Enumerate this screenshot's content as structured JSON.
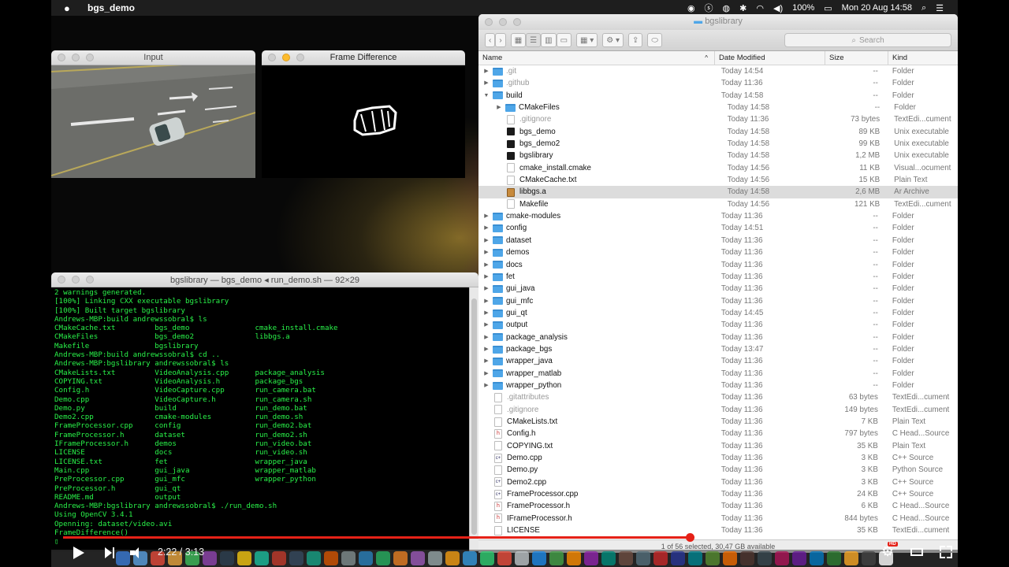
{
  "menubar": {
    "apple": "",
    "app_name": "bgs_demo",
    "battery": "100%",
    "datetime": "Mon 20 Aug  14:58"
  },
  "input_window": {
    "title": "Input"
  },
  "diff_window": {
    "title": "Frame Difference"
  },
  "terminal": {
    "title": "bgslibrary — bgs_demo ◂ run_demo.sh — 92×29",
    "lines": [
      "2 warnings generated.",
      "[100%] Linking CXX executable bgslibrary",
      "[100%] Built target bgslibrary",
      "Andrews-MBP:build andrewssobral$ ls",
      "CMakeCache.txt         bgs_demo               cmake_install.cmake",
      "CMakeFiles             bgs_demo2              libbgs.a",
      "Makefile               bgslibrary",
      "Andrews-MBP:build andrewssobral$ cd ..",
      "Andrews-MBP:bgslibrary andrewssobral$ ls",
      "CMakeLists.txt         VideoAnalysis.cpp      package_analysis",
      "COPYING.txt            VideoAnalysis.h        package_bgs",
      "Config.h               VideoCapture.cpp       run_camera.bat",
      "Demo.cpp               VideoCapture.h         run_camera.sh",
      "Demo.py                build                  run_demo.bat",
      "Demo2.cpp              cmake-modules          run_demo.sh",
      "FrameProcessor.cpp     config                 run_demo2.bat",
      "FrameProcessor.h       dataset                run_demo2.sh",
      "IFrameProcessor.h      demos                  run_video.bat",
      "LICENSE                docs                   run_video.sh",
      "LICENSE.txt            fet                    wrapper_java",
      "Main.cpp               gui_java               wrapper_matlab",
      "PreProcessor.cpp       gui_mfc                wrapper_python",
      "PreProcessor.h         gui_qt",
      "README.md              output",
      "Andrews-MBP:bgslibrary andrewssobral$ ./run_demo.sh",
      "Using OpenCV 3.4.1",
      "Openning: dataset/video.avi",
      "FrameDifference()",
      "▯"
    ]
  },
  "finder": {
    "title": "bgslibrary",
    "search_placeholder": "Search",
    "columns": {
      "name": "Name",
      "date": "Date Modified",
      "size": "Size",
      "kind": "Kind"
    },
    "rows": [
      {
        "indent": 0,
        "tri": "▶",
        "icon": "folder",
        "name": ".git",
        "date": "Today 14:54",
        "size": "--",
        "kind": "Folder",
        "dim": true
      },
      {
        "indent": 0,
        "tri": "▶",
        "icon": "folder",
        "name": ".github",
        "date": "Today 11:36",
        "size": "--",
        "kind": "Folder",
        "dim": true
      },
      {
        "indent": 0,
        "tri": "▼",
        "icon": "folder",
        "name": "build",
        "date": "Today 14:58",
        "size": "--",
        "kind": "Folder",
        "dim": false
      },
      {
        "indent": 1,
        "tri": "▶",
        "icon": "folder",
        "name": "CMakeFiles",
        "date": "Today 14:58",
        "size": "--",
        "kind": "Folder",
        "dim": false
      },
      {
        "indent": 1,
        "tri": "",
        "icon": "doc",
        "name": ".gitignore",
        "date": "Today 11:36",
        "size": "73 bytes",
        "kind": "TextEdi...cument",
        "dim": true
      },
      {
        "indent": 1,
        "tri": "",
        "icon": "exec",
        "name": "bgs_demo",
        "date": "Today 14:58",
        "size": "89 KB",
        "kind": "Unix executable",
        "dim": false
      },
      {
        "indent": 1,
        "tri": "",
        "icon": "exec",
        "name": "bgs_demo2",
        "date": "Today 14:58",
        "size": "99 KB",
        "kind": "Unix executable",
        "dim": false
      },
      {
        "indent": 1,
        "tri": "",
        "icon": "exec",
        "name": "bgslibrary",
        "date": "Today 14:58",
        "size": "1,2 MB",
        "kind": "Unix executable",
        "dim": false
      },
      {
        "indent": 1,
        "tri": "",
        "icon": "doc",
        "name": "cmake_install.cmake",
        "date": "Today 14:56",
        "size": "11 KB",
        "kind": "Visual...ocument",
        "dim": false
      },
      {
        "indent": 1,
        "tri": "",
        "icon": "doc",
        "name": "CMakeCache.txt",
        "date": "Today 14:56",
        "size": "15 KB",
        "kind": "Plain Text",
        "dim": false
      },
      {
        "indent": 1,
        "tri": "",
        "icon": "ar",
        "name": "libbgs.a",
        "date": "Today 14:58",
        "size": "2,6 MB",
        "kind": "Ar Archive",
        "dim": false,
        "sel": true
      },
      {
        "indent": 1,
        "tri": "",
        "icon": "doc",
        "name": "Makefile",
        "date": "Today 14:56",
        "size": "121 KB",
        "kind": "TextEdi...cument",
        "dim": false
      },
      {
        "indent": 0,
        "tri": "▶",
        "icon": "folder",
        "name": "cmake-modules",
        "date": "Today 11:36",
        "size": "--",
        "kind": "Folder",
        "dim": false
      },
      {
        "indent": 0,
        "tri": "▶",
        "icon": "folder",
        "name": "config",
        "date": "Today 14:51",
        "size": "--",
        "kind": "Folder",
        "dim": false
      },
      {
        "indent": 0,
        "tri": "▶",
        "icon": "folder",
        "name": "dataset",
        "date": "Today 11:36",
        "size": "--",
        "kind": "Folder",
        "dim": false
      },
      {
        "indent": 0,
        "tri": "▶",
        "icon": "folder",
        "name": "demos",
        "date": "Today 11:36",
        "size": "--",
        "kind": "Folder",
        "dim": false
      },
      {
        "indent": 0,
        "tri": "▶",
        "icon": "folder",
        "name": "docs",
        "date": "Today 11:36",
        "size": "--",
        "kind": "Folder",
        "dim": false
      },
      {
        "indent": 0,
        "tri": "▶",
        "icon": "folder",
        "name": "fet",
        "date": "Today 11:36",
        "size": "--",
        "kind": "Folder",
        "dim": false
      },
      {
        "indent": 0,
        "tri": "▶",
        "icon": "folder",
        "name": "gui_java",
        "date": "Today 11:36",
        "size": "--",
        "kind": "Folder",
        "dim": false
      },
      {
        "indent": 0,
        "tri": "▶",
        "icon": "folder",
        "name": "gui_mfc",
        "date": "Today 11:36",
        "size": "--",
        "kind": "Folder",
        "dim": false
      },
      {
        "indent": 0,
        "tri": "▶",
        "icon": "folder",
        "name": "gui_qt",
        "date": "Today 14:45",
        "size": "--",
        "kind": "Folder",
        "dim": false
      },
      {
        "indent": 0,
        "tri": "▶",
        "icon": "folder",
        "name": "output",
        "date": "Today 11:36",
        "size": "--",
        "kind": "Folder",
        "dim": false
      },
      {
        "indent": 0,
        "tri": "▶",
        "icon": "folder",
        "name": "package_analysis",
        "date": "Today 11:36",
        "size": "--",
        "kind": "Folder",
        "dim": false
      },
      {
        "indent": 0,
        "tri": "▶",
        "icon": "folder",
        "name": "package_bgs",
        "date": "Today 13:47",
        "size": "--",
        "kind": "Folder",
        "dim": false
      },
      {
        "indent": 0,
        "tri": "▶",
        "icon": "folder",
        "name": "wrapper_java",
        "date": "Today 11:36",
        "size": "--",
        "kind": "Folder",
        "dim": false
      },
      {
        "indent": 0,
        "tri": "▶",
        "icon": "folder",
        "name": "wrapper_matlab",
        "date": "Today 11:36",
        "size": "--",
        "kind": "Folder",
        "dim": false
      },
      {
        "indent": 0,
        "tri": "▶",
        "icon": "folder",
        "name": "wrapper_python",
        "date": "Today 11:36",
        "size": "--",
        "kind": "Folder",
        "dim": false
      },
      {
        "indent": 0,
        "tri": "",
        "icon": "doc",
        "name": ".gitattributes",
        "date": "Today 11:36",
        "size": "63 bytes",
        "kind": "TextEdi...cument",
        "dim": true
      },
      {
        "indent": 0,
        "tri": "",
        "icon": "doc",
        "name": ".gitignore",
        "date": "Today 11:36",
        "size": "149 bytes",
        "kind": "TextEdi...cument",
        "dim": true
      },
      {
        "indent": 0,
        "tri": "",
        "icon": "doc",
        "name": "CMakeLists.txt",
        "date": "Today 11:36",
        "size": "7 KB",
        "kind": "Plain Text",
        "dim": false
      },
      {
        "indent": 0,
        "tri": "",
        "icon": "h",
        "name": "Config.h",
        "date": "Today 11:36",
        "size": "797 bytes",
        "kind": "C Head...Source",
        "dim": false
      },
      {
        "indent": 0,
        "tri": "",
        "icon": "doc",
        "name": "COPYING.txt",
        "date": "Today 11:36",
        "size": "35 KB",
        "kind": "Plain Text",
        "dim": false
      },
      {
        "indent": 0,
        "tri": "",
        "icon": "cpp",
        "name": "Demo.cpp",
        "date": "Today 11:36",
        "size": "3 KB",
        "kind": "C++ Source",
        "dim": false
      },
      {
        "indent": 0,
        "tri": "",
        "icon": "doc",
        "name": "Demo.py",
        "date": "Today 11:36",
        "size": "3 KB",
        "kind": "Python Source",
        "dim": false
      },
      {
        "indent": 0,
        "tri": "",
        "icon": "cpp",
        "name": "Demo2.cpp",
        "date": "Today 11:36",
        "size": "3 KB",
        "kind": "C++ Source",
        "dim": false
      },
      {
        "indent": 0,
        "tri": "",
        "icon": "cpp",
        "name": "FrameProcessor.cpp",
        "date": "Today 11:36",
        "size": "24 KB",
        "kind": "C++ Source",
        "dim": false
      },
      {
        "indent": 0,
        "tri": "",
        "icon": "h",
        "name": "FrameProcessor.h",
        "date": "Today 11:36",
        "size": "6 KB",
        "kind": "C Head...Source",
        "dim": false
      },
      {
        "indent": 0,
        "tri": "",
        "icon": "h",
        "name": "IFrameProcessor.h",
        "date": "Today 11:36",
        "size": "844 bytes",
        "kind": "C Head...Source",
        "dim": false
      },
      {
        "indent": 0,
        "tri": "",
        "icon": "doc",
        "name": "LICENSE",
        "date": "Today 11:36",
        "size": "35 KB",
        "kind": "TextEdi...cument",
        "dim": false
      }
    ],
    "status": "1 of 56 selected, 30,47 GB available"
  },
  "player": {
    "time": "2:22 / 3:13",
    "progress": 0.71,
    "hd_badge": "HD"
  },
  "colors": {
    "terminal_text": "#29f249",
    "progress": "#e52117",
    "folder": "#4ea6e8"
  }
}
